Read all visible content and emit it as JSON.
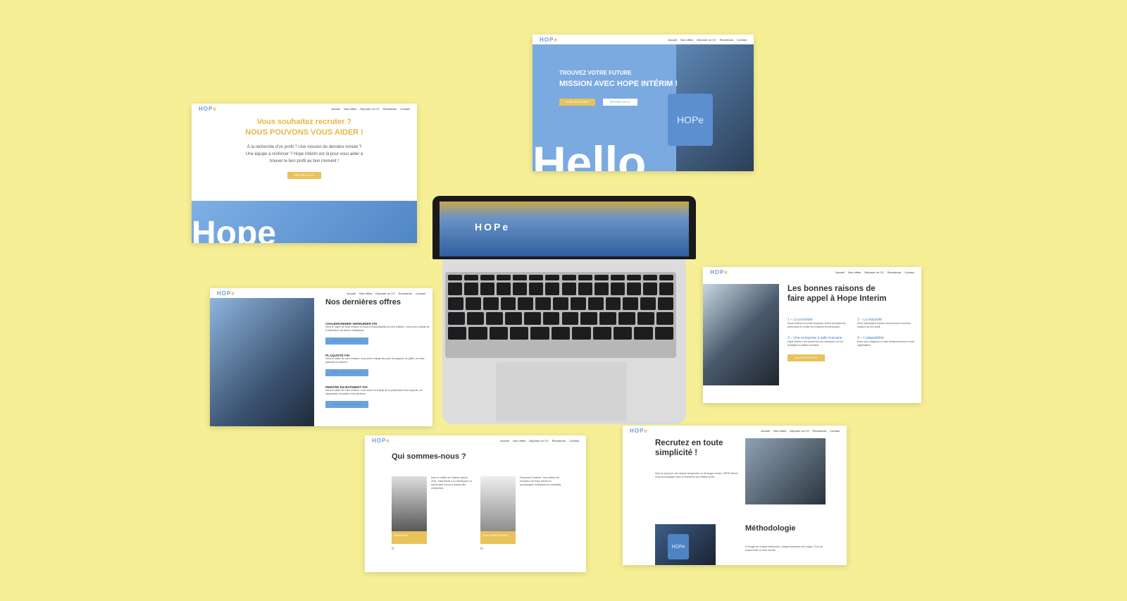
{
  "nav": {
    "logo": "HOP",
    "logo_e": "e",
    "links": [
      "Accueil",
      "Nos offres",
      "Déposer un CV",
      "Recruteurs",
      "Contact"
    ]
  },
  "recruit": {
    "line1": "Vous souhaitez recruter ?",
    "line2": "NOUS POUVONS VOUS AIDER !",
    "body1": "À la recherche d'un profil ? Une mission de dernière minute ?",
    "body2": "Une équipe à renforcer ? Hope Intérim est là pour vous aider à",
    "body3": "trouver le bon profil au bon moment !",
    "button": "DÉPOSER UN CV",
    "hero": "Hope"
  },
  "hello": {
    "line1": "TROUVEZ VOTRE FUTURE",
    "line2": "MISSION AVEC HOPE INTÉRIM !",
    "btn1": "VOIR LES OFFRES",
    "btn2": "DÉPOSER UN CV",
    "big": "Hello",
    "mug": "HOPe"
  },
  "laptop": {
    "logo": "HOPe"
  },
  "offers": {
    "title": "Nos dernières offres",
    "jobs": [
      {
        "title": "CHAUDRONNIER SERRURIER F/H",
        "desc": "Dans le cadre de votre mission et sous la responsabilité du chef d'atelier, vous serez chargé de la fabrication de pièces métalliques.",
        "btn": "VOIR L'OFFRE D'EMPLOI"
      },
      {
        "title": "PLAQUISTE F/H",
        "desc": "Dans le cadre de votre mission, vous serez chargé de poser les plaques de plâtre, les faux plafonds et cloisons.",
        "btn": "VOIR L'OFFRE D'EMPLOI"
      },
      {
        "title": "PEINTRE EN BATIMENT F/H",
        "desc": "Dans le cadre de votre mission, vous serez en charge de la préparation des supports, de l'application d'enduits et de peintures.",
        "btn": "VOIR L'OFFRE D'EMPLOI"
      }
    ]
  },
  "reasons": {
    "title1": "Les bonnes raisons de",
    "title2": "faire appel à Hope Interim",
    "items": [
      {
        "h": "1 – La proximité",
        "t": "Nous mettons en profit d'avancer à bien connaître les personnes et confier les missions et entreprises."
      },
      {
        "h": "2 – La réactivité",
        "t": "Deux intérimaires formés nous trouvons la bonne solution au bon profil."
      },
      {
        "h": "3 – Une entreprise à taille humaine",
        "t": "Hope Intérim c'est avant tout une entreprise où l'on privilégie la relation humaine."
      },
      {
        "h": "4 – L'adaptabilité",
        "t": "Nous nous adaptons à votre fonctionnement et votre organisation."
      }
    ],
    "button": "NOUS CONTACTER"
  },
  "about": {
    "title": "Qui sommes-nous ?",
    "p1": "Nina Barnil",
    "p2": "Jean-Albert Ferreira",
    "text1": "Dans le métier de l'intérim depuis 2001, Elise Barnil a su développer un savoir-faire reconnu auprès des entreprises.",
    "text2": "Passionné d'intérim, Jean-Albert est fondateur de Hope Intérim et accompagne entreprises et candidats.",
    "social": "in"
  },
  "simple": {
    "title1": "Recrutez en toute",
    "title2": "simplicité !",
    "text": "Que ce soit pour une mission temporaire ou de longue durée, HOPE Intérim vous accompagne dans la recherche du meilleur profil.",
    "method": "Méthodologie",
    "mtext": "À l'image de chaque intérimaire, chaque entreprise est unique. D'où de toujours être à votre écoute.",
    "mug": "HOPe"
  },
  "colors": {
    "bg": "#f6ef95",
    "accent": "#e8b63f",
    "blue": "#6aa2de"
  }
}
